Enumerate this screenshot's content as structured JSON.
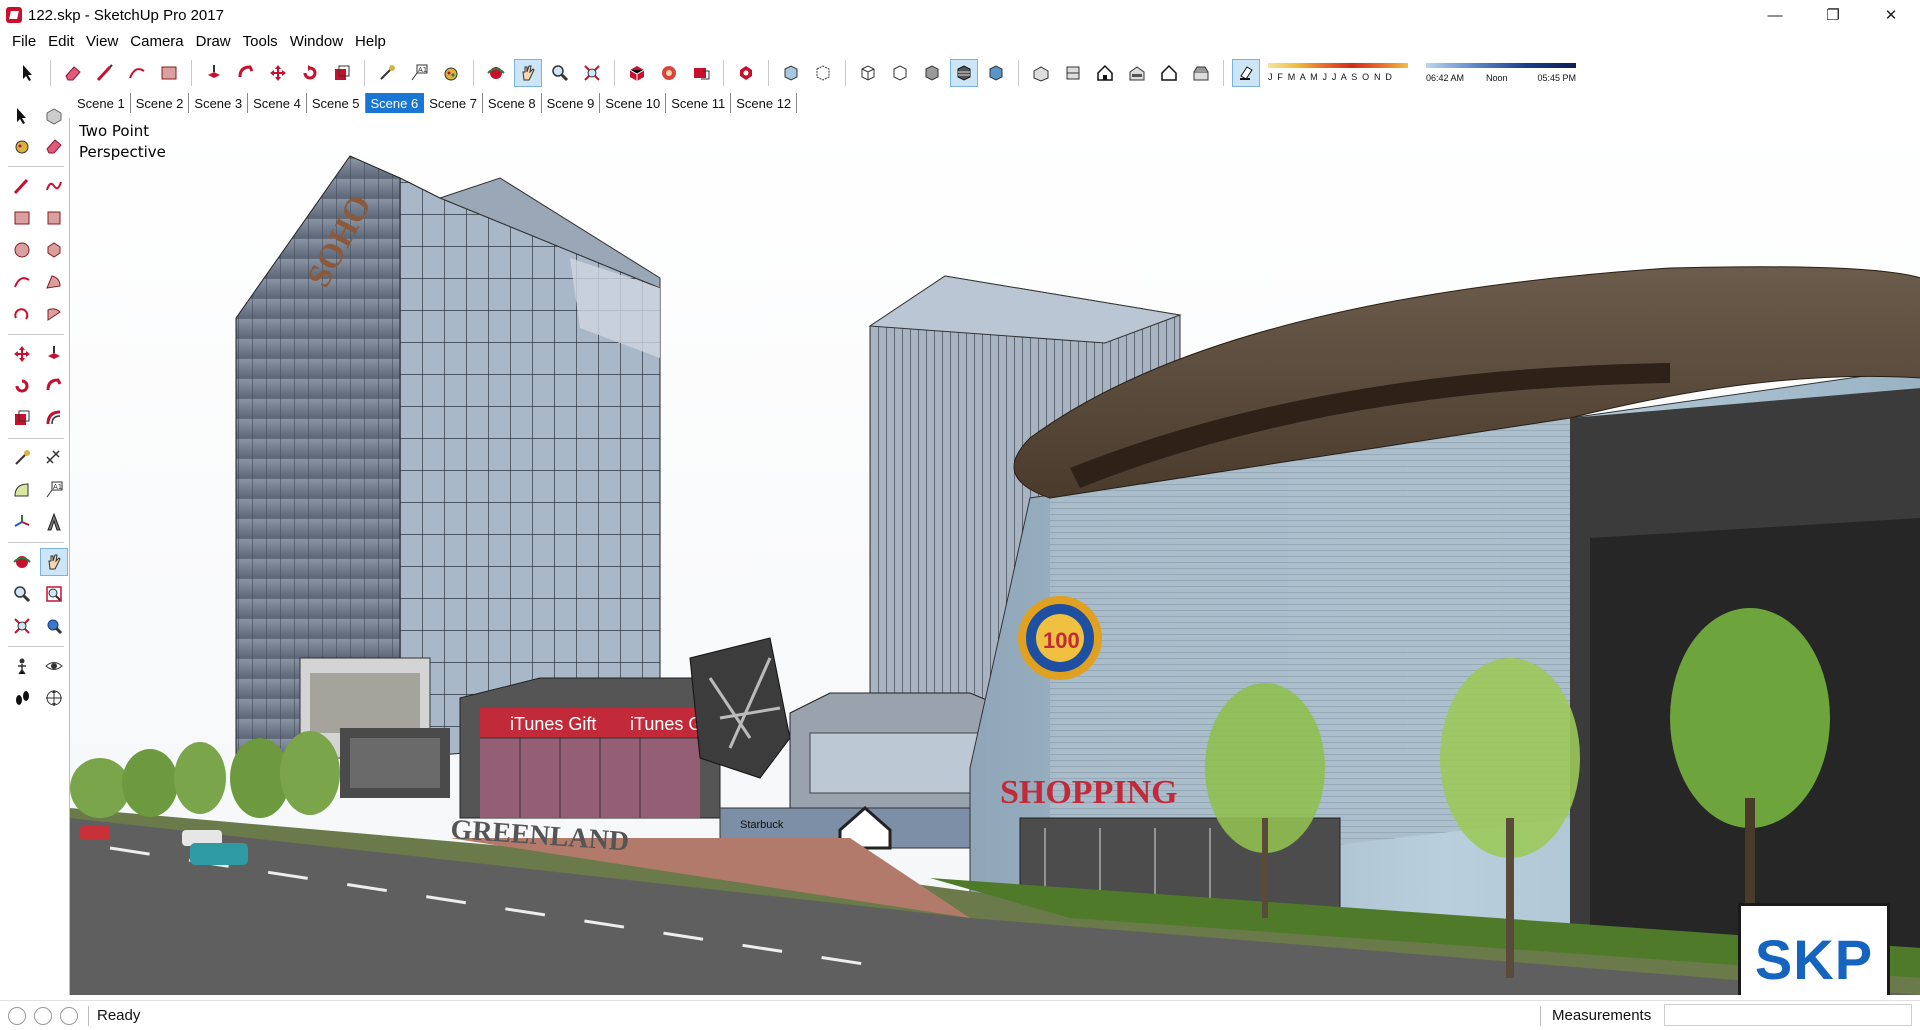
{
  "window": {
    "title": "122.skp - SketchUp Pro 2017",
    "minimize_glyph": "—",
    "restore_glyph": "❐",
    "close_glyph": "✕"
  },
  "menu": [
    "File",
    "Edit",
    "View",
    "Camera",
    "Draw",
    "Tools",
    "Window",
    "Help"
  ],
  "toolbar": {
    "months_label": "J F M A M J J A S O N D",
    "time_start": "06:42 AM",
    "time_mid": "Noon",
    "time_end": "05:45 PM"
  },
  "scenes": {
    "tabs": [
      "Scene 1",
      "Scene 2",
      "Scene 3",
      "Scene 4",
      "Scene 5",
      "Scene 6",
      "Scene 7",
      "Scene 8",
      "Scene 9",
      "Scene 10",
      "Scene 11",
      "Scene 12"
    ],
    "active_index": 5
  },
  "viewport": {
    "camera_mode": "Two Point Perspective",
    "signs": {
      "soho": "SOHO",
      "itunes_left": "iTunes Gift",
      "itunes_right": "iTunes Gi",
      "greenland": "GREENLAND",
      "shopping": "SHOPPING",
      "badge_number": "100",
      "starbucks": "Starbuck"
    },
    "watermark": "SKP"
  },
  "status": {
    "text": "Ready",
    "measurements_label": "Measurements",
    "measurements_value": ""
  },
  "colors": {
    "accent": "#1976d2",
    "active_button": "#cde6f7",
    "sketchup_red": "#c8102e"
  }
}
